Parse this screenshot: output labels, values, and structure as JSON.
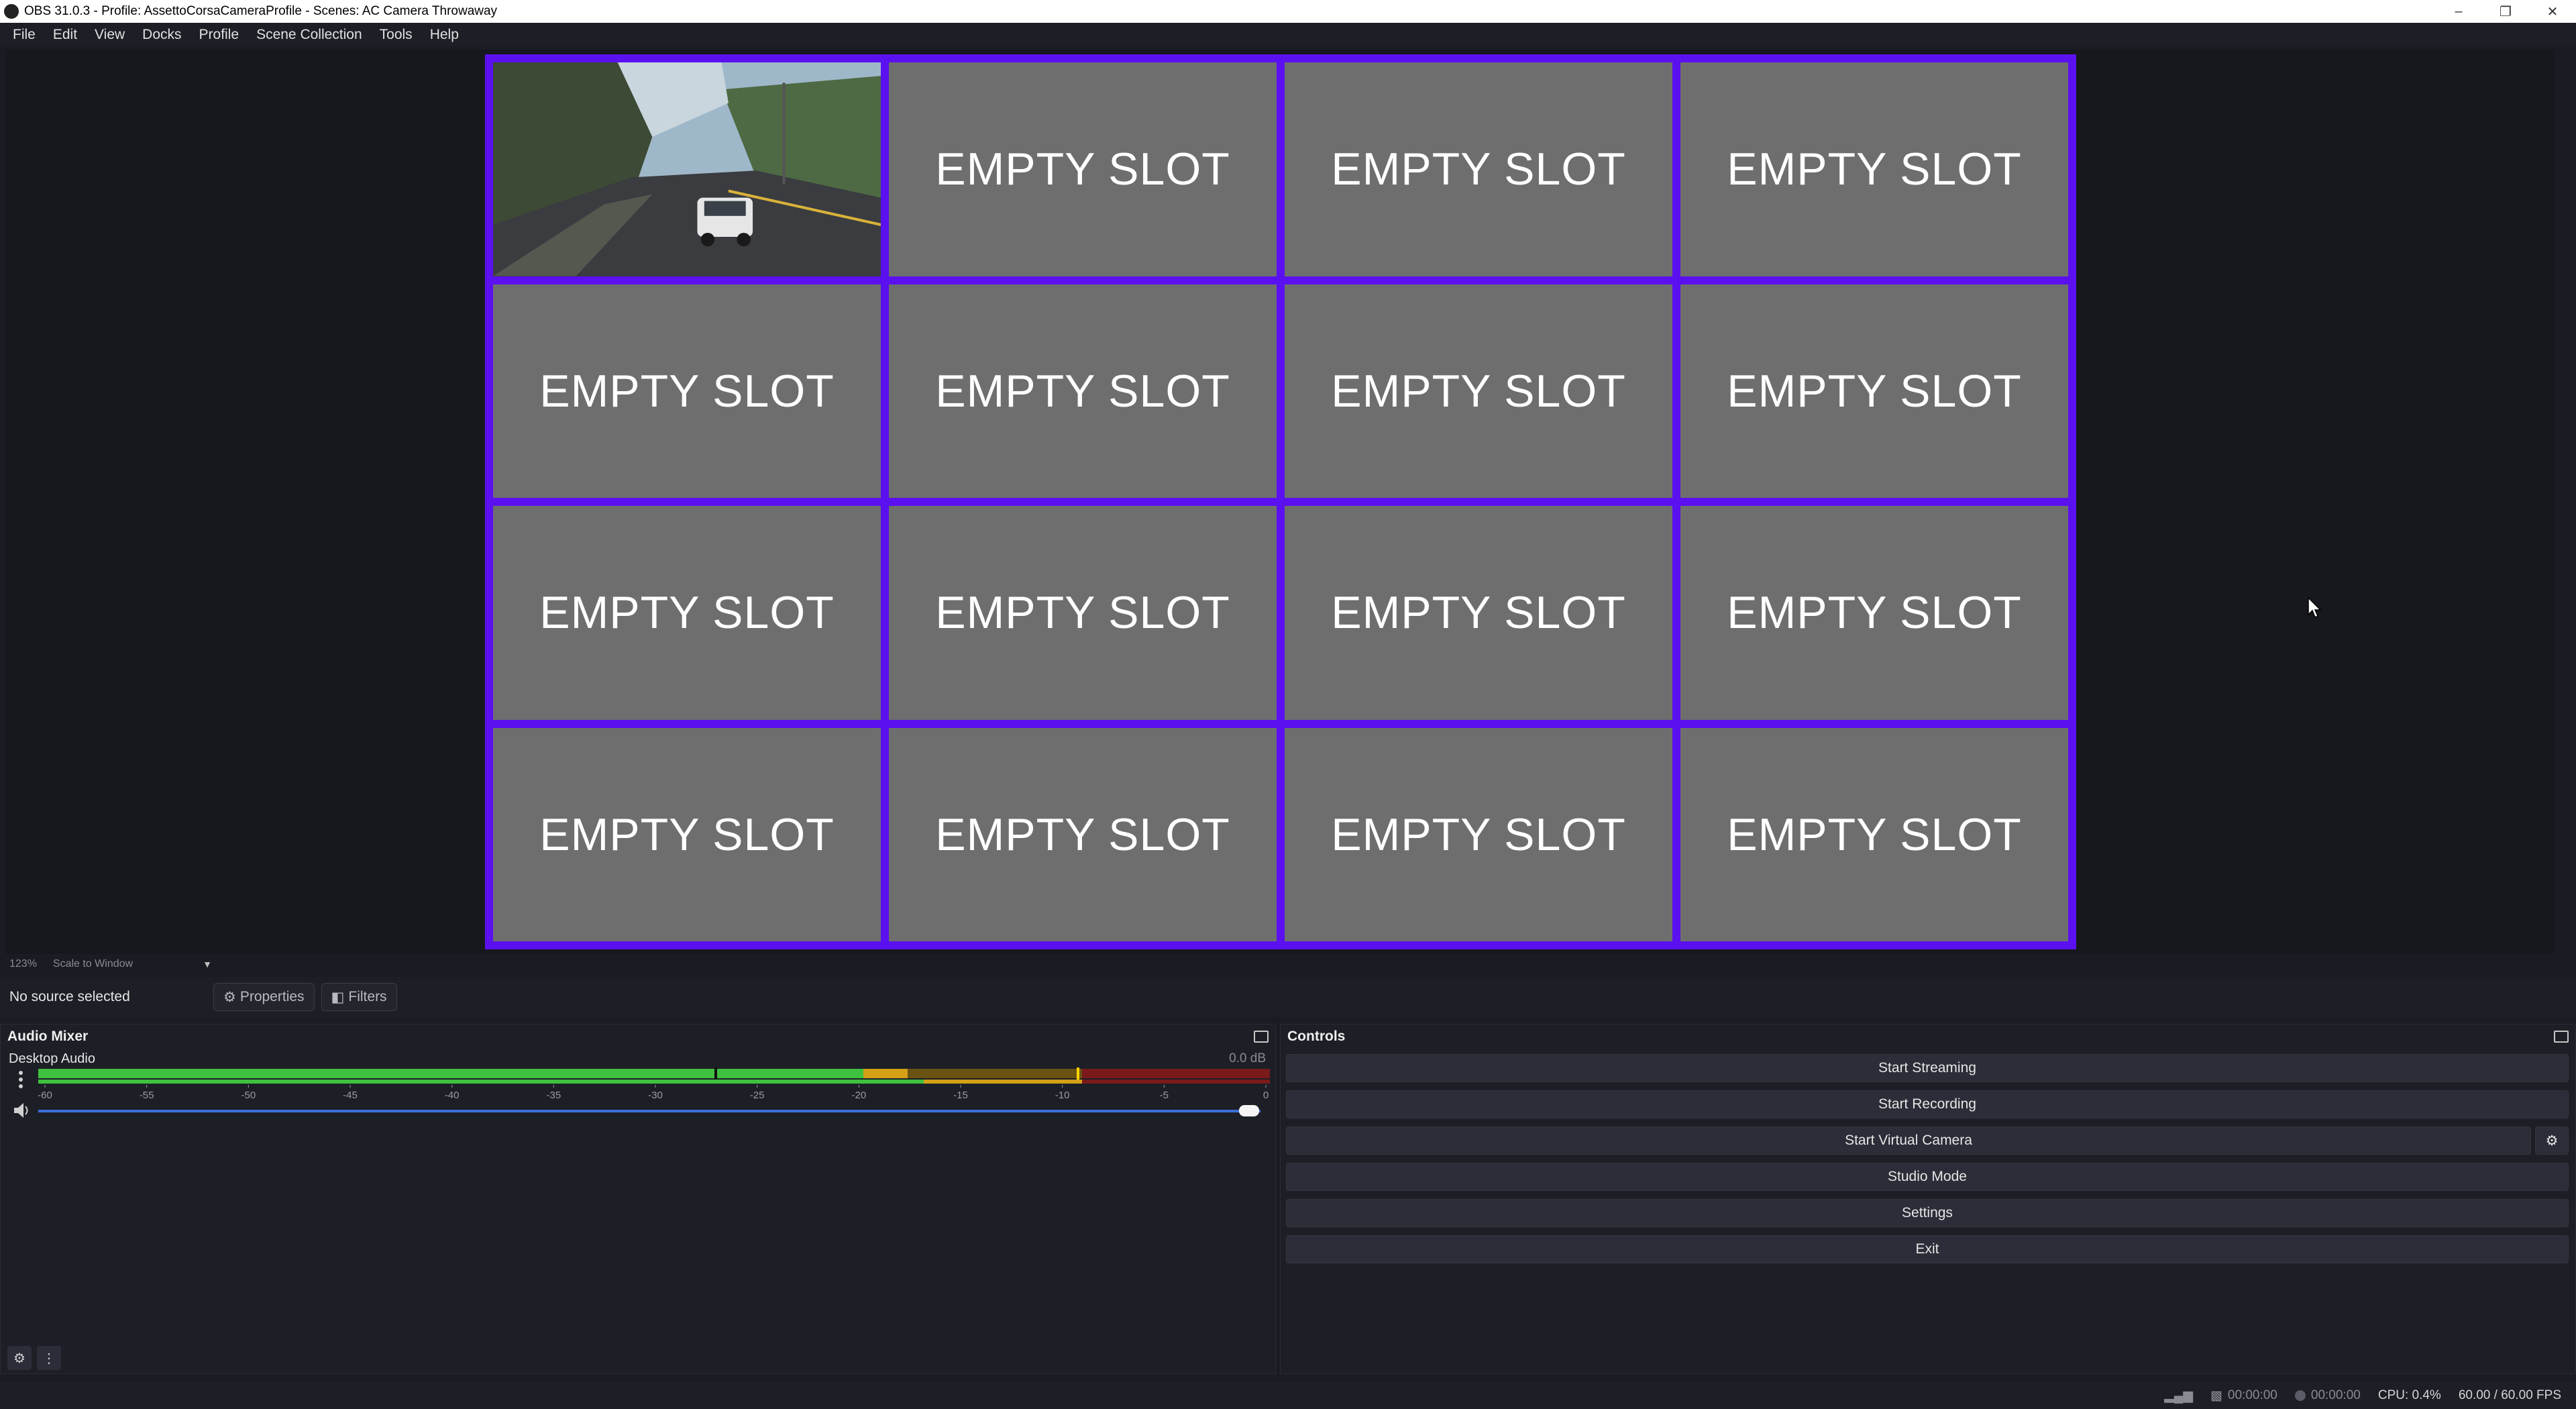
{
  "window": {
    "title": "OBS 31.0.3 - Profile: AssettoCorsaCameraProfile - Scenes: AC Camera Throwaway"
  },
  "menu": [
    "File",
    "Edit",
    "View",
    "Docks",
    "Profile",
    "Scene Collection",
    "Tools",
    "Help"
  ],
  "preview": {
    "slot_label": "EMPTY SLOT",
    "slots": [
      "",
      "EMPTY SLOT",
      "EMPTY SLOT",
      "EMPTY SLOT",
      "EMPTY SLOT",
      "EMPTY SLOT",
      "EMPTY SLOT",
      "EMPTY SLOT",
      "EMPTY SLOT",
      "EMPTY SLOT",
      "EMPTY SLOT",
      "EMPTY SLOT",
      "EMPTY SLOT",
      "EMPTY SLOT",
      "EMPTY SLOT",
      "EMPTY SLOT"
    ],
    "border_color": "#5b10f0",
    "zoom": "123%",
    "scale_mode": "Scale to Window"
  },
  "source_toolbar": {
    "no_source": "No source selected",
    "properties": "Properties",
    "filters": "Filters"
  },
  "audio_mixer": {
    "title": "Audio Mixer",
    "channel": {
      "name": "Desktop Audio",
      "db": "0.0 dB",
      "volume_level": 1.0
    },
    "scale_labels": [
      "-60",
      "-55",
      "-50",
      "-45",
      "-40",
      "-35",
      "-30",
      "-25",
      "-20",
      "-15",
      "-10",
      "-5",
      "0"
    ]
  },
  "controls": {
    "title": "Controls",
    "start_streaming": "Start Streaming",
    "start_recording": "Start Recording",
    "start_virtual_camera": "Start Virtual Camera",
    "studio_mode": "Studio Mode",
    "settings": "Settings",
    "exit": "Exit"
  },
  "status": {
    "stream_time": "00:00:00",
    "record_time": "00:00:00",
    "cpu": "CPU: 0.4%",
    "fps": "60.00 / 60.00 FPS"
  },
  "colors": {
    "meter_green": "#3fc13f",
    "meter_yellow": "#d4a017",
    "meter_red": "#c62828",
    "slider_blue": "#3a6fd8"
  }
}
